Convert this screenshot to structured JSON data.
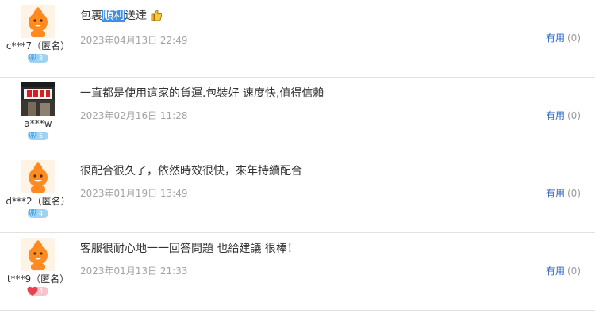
{
  "reviews": [
    {
      "user": "c***7（匿名）",
      "avatar": "orange-mascot",
      "badge": "diamond",
      "badge_level": "3",
      "comment_before": "包裏",
      "comment_highlight": "順利",
      "comment_after": "送達",
      "has_thumb": true,
      "date": "2023年04月13日 22:49",
      "helpful_label": "有用",
      "helpful_count": "(0)"
    },
    {
      "user": "a***w",
      "avatar": "shop-photo",
      "badge": "diamond",
      "badge_level": "5",
      "comment_before": "一直都是使用這家的貨運.包裝好 速度快,值得信賴",
      "comment_highlight": "",
      "comment_after": "",
      "has_thumb": false,
      "date": "2023年02月16日 11:28",
      "helpful_label": "有用",
      "helpful_count": "(0)"
    },
    {
      "user": "d***2（匿名）",
      "avatar": "orange-mascot",
      "badge": "diamond",
      "badge_level": "4",
      "comment_before": "很配合很久了，依然時效很快，來年持續配合",
      "comment_highlight": "",
      "comment_after": "",
      "has_thumb": false,
      "date": "2023年01月19日 13:49",
      "helpful_label": "有用",
      "helpful_count": "(0)"
    },
    {
      "user": "t***9（匿名）",
      "avatar": "orange-mascot",
      "badge": "heart",
      "badge_level": "4",
      "comment_before": "客服很耐心地一一回答問題 也給建議 很棒！",
      "comment_highlight": "",
      "comment_after": "",
      "has_thumb": false,
      "date": "2023年01月13日 21:33",
      "helpful_label": "有用",
      "helpful_count": "(0)"
    }
  ],
  "colors": {
    "link": "#2b67c2",
    "date": "#a3a3a3",
    "divider": "#e1e1e1",
    "highlight": "#3f8ee8",
    "diamond_badge": "#9fd3f1",
    "heart_badge": "#f6c5cc",
    "mascot": "#ff8a1f"
  }
}
